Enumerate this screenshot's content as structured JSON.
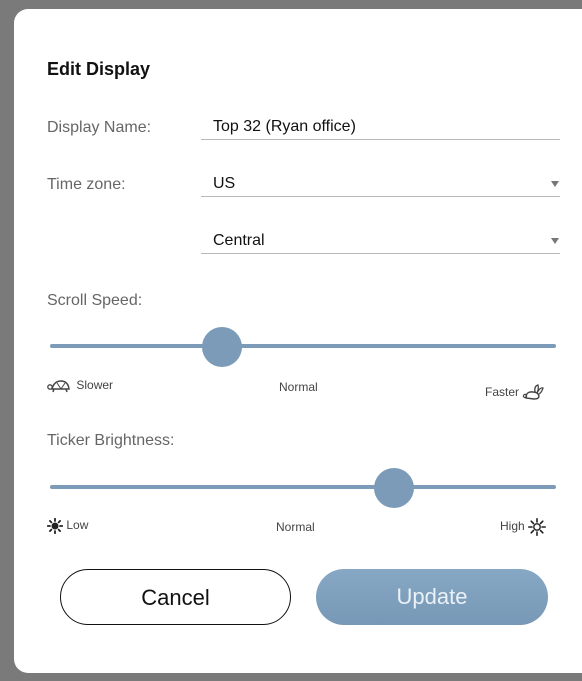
{
  "dialog": {
    "title": "Edit Display",
    "display_name": {
      "label": "Display Name:",
      "value": "Top 32 (Ryan office)"
    },
    "time_zone": {
      "label": "Time zone:",
      "region": "US",
      "zone": "Central"
    },
    "scroll_speed": {
      "label": "Scroll Speed:",
      "value_fraction": 0.34,
      "min_label": "Slower",
      "mid_label": "Normal",
      "max_label": "Faster",
      "min_icon": "turtle-icon",
      "max_icon": "rabbit-icon"
    },
    "brightness": {
      "label": "Ticker Brightness:",
      "value_fraction": 0.68,
      "min_label": "Low",
      "mid_label": "Normal",
      "max_label": "High",
      "min_icon": "sun-low-icon",
      "max_icon": "sun-high-icon"
    },
    "buttons": {
      "cancel": "Cancel",
      "update": "Update"
    }
  },
  "colors": {
    "accent": "#7b9bb8",
    "overlay": "#7a7a7a"
  }
}
